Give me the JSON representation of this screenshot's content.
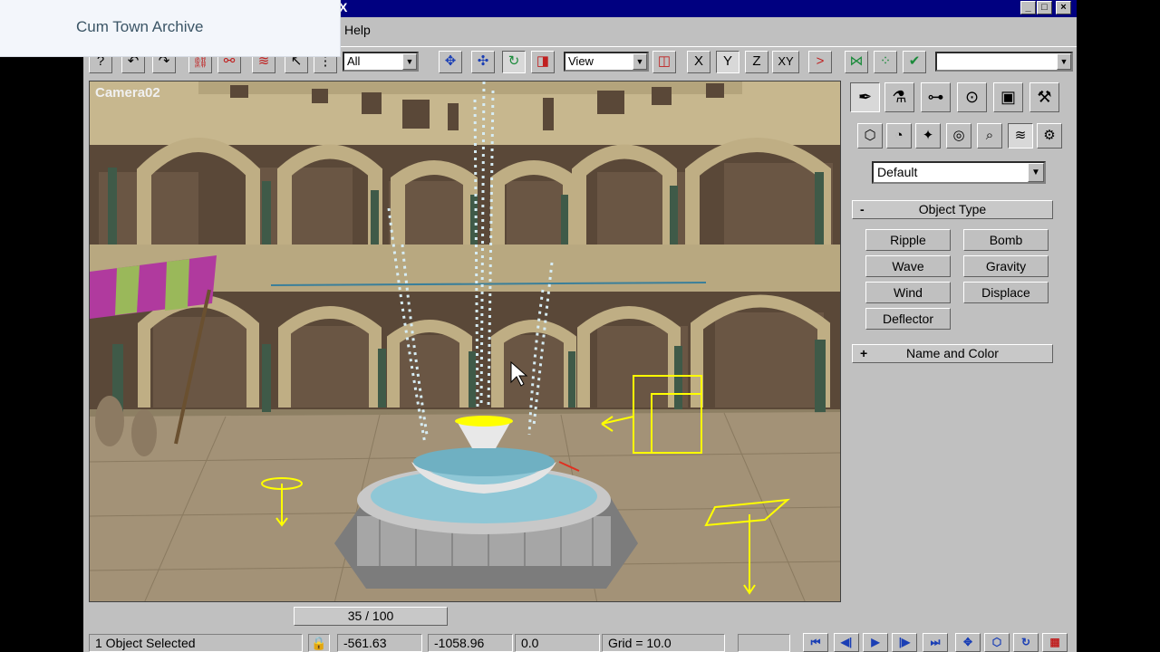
{
  "overlay": {
    "text": "Cum Town Archive"
  },
  "title_bar": {
    "close_glyph": "X"
  },
  "menu": {
    "help": "Help"
  },
  "toolbar": {
    "selection_filter": "All",
    "ref_coord_system": "View",
    "axis_x": "X",
    "axis_y": "Y",
    "axis_z": "Z",
    "axis_xy": "XY",
    "named_selection": ""
  },
  "viewport": {
    "label": "Camera02",
    "scene": {
      "walls": "#c9b88f",
      "brick": "#5a4838",
      "columns": "#3f5a48",
      "floor": "#a39277",
      "water": "#8fc7d6",
      "selection": "#ffff00"
    }
  },
  "command_panel": {
    "tabs": [
      "create-icon",
      "modify-icon",
      "hierarchy-icon",
      "motion-icon",
      "display-icon",
      "utilities-icon"
    ],
    "subcategories": [
      "geometry-icon",
      "shapes-icon",
      "lights-icon",
      "cameras-icon",
      "helpers-icon",
      "space-warps-icon",
      "systems-icon"
    ],
    "category": "Default",
    "object_type": {
      "sign": "-",
      "title": "Object Type"
    },
    "buttons": [
      "Ripple",
      "Bomb",
      "Wave",
      "Gravity",
      "Wind",
      "Displace",
      "Deflector"
    ],
    "name_and_color": {
      "sign": "+",
      "title": "Name and Color"
    }
  },
  "time_slider": {
    "label": "35 / 100",
    "value": 35,
    "max": 100
  },
  "status": {
    "selection": "1 Object Selected",
    "x": "-561.63",
    "y": "-1058.96",
    "z": "0.0",
    "grid": "Grid = 10.0"
  }
}
